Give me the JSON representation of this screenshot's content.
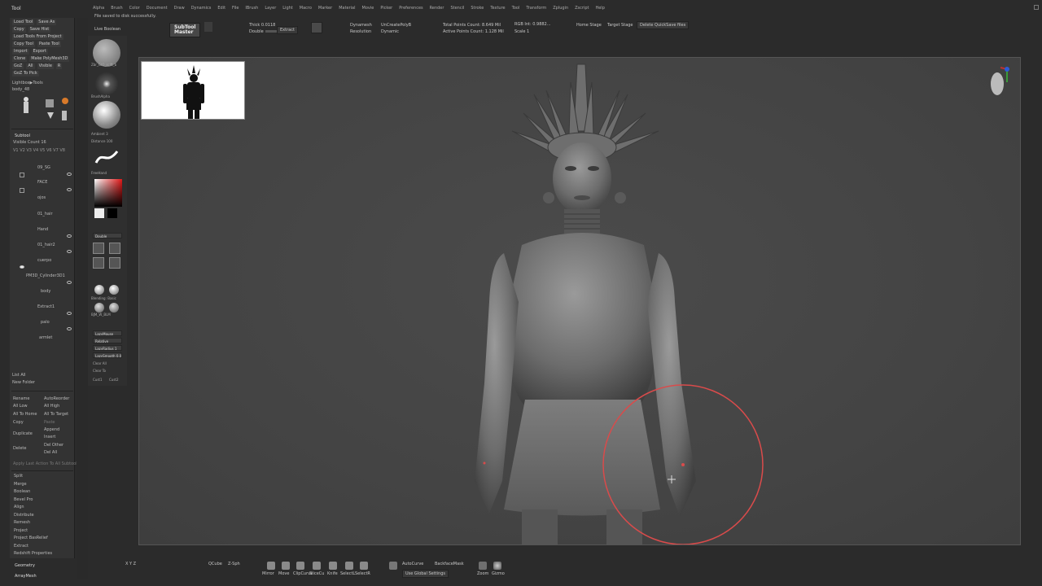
{
  "app": {
    "title": "Tool"
  },
  "menubar": {
    "items": [
      "Alpha",
      "Brush",
      "Color",
      "Document",
      "Draw",
      "Dynamics",
      "Edit",
      "File",
      "IBrush",
      "Layer",
      "Light",
      "Macro",
      "Marker",
      "Material",
      "Movie",
      "Picker",
      "Preferences",
      "Render",
      "Stencil",
      "Stroke",
      "Texture",
      "Tool",
      "Transform",
      "Zplugin",
      "Zscript",
      "Help"
    ]
  },
  "status": {
    "message": "File saved to disk successfully."
  },
  "top_shelf": {
    "live_boolean": "Live Boolean",
    "subtool_master_1": "SubTool",
    "subtool_master_2": "Master",
    "extract": "Extract",
    "thick": "Thick 0.0118",
    "double": "Double",
    "zremesher_1": "Dynamesh",
    "zremesher_2": "Resolution",
    "create_poly": "UnCreatePolyB",
    "dynamic": "Dynamic",
    "total_points": "Total Points Count: 8.649 Mil",
    "active_points": "Active Points Count: 1.128 Mil",
    "rgb": "RGB Int: 0.9882...",
    "scale": "Scale 1",
    "home_stage": "Home Stage",
    "target_stage": "Target Stage",
    "delete_quicksave": "Delete QuickSave files"
  },
  "left_panel": {
    "row1": [
      "Load Tool",
      "Save As"
    ],
    "row2": [
      "Copy",
      "Save Hist"
    ],
    "row3": [
      "Load Tools From Project"
    ],
    "row4": [
      "Copy Tool",
      "Paste Tool"
    ],
    "row5": [
      "Import",
      "Export"
    ],
    "row6": [
      "Clone",
      "Make PolyMesh3D"
    ],
    "row7": [
      "GoZ",
      "All",
      "Visible",
      "R"
    ],
    "row8": [
      "GoZ To Pick"
    ],
    "lightbox": "Lightbox▶Tools",
    "body_count": "body_48",
    "subtool_title": "Subtool",
    "visible_count": "Visible Count 16",
    "subtools": [
      "09_SG",
      "FACE",
      "ojos",
      "01_hair",
      "Hand",
      "01_hair2",
      "cuerpo",
      "PM3D_Cylinder3D1",
      "body",
      "Extract1",
      "palo",
      "armlet"
    ],
    "list_all": "List All",
    "new_folder": "New Folder",
    "ops": [
      [
        "Rename",
        "AutoReorder"
      ],
      [
        "All Low",
        "All High"
      ],
      [
        "All To Home",
        "All To Target"
      ],
      [
        "Copy",
        "Paste"
      ],
      [
        "Duplicate",
        "Append"
      ],
      [
        "",
        "Insert"
      ],
      [
        "Delete",
        "Del Other"
      ],
      [
        "",
        "Del All"
      ]
    ],
    "apply_text": "Apply Last Action To All Subtool",
    "menu": [
      "Split",
      "Merge",
      "Boolean",
      "Bevel Pro",
      "Align",
      "Distribute",
      "Remesh",
      "Project",
      "Project BasRelief",
      "Extract",
      "Redshift Properties"
    ],
    "bottom": [
      "Geometry",
      "ArrayMesh"
    ]
  },
  "palette2": {
    "items": [
      "Zbr_GIO_scift_b",
      "BrushAlpha",
      "Ambient 3",
      "Distance 100",
      "FreeHand",
      "Double",
      "Draw",
      "Scale",
      "Zgrid",
      "PolyF",
      "Fill",
      "LazyMouse",
      "Relative",
      "LazyRadius 1",
      "LazySmooth 0.08",
      "Clear All",
      "Clear To",
      "Cust1",
      "Cust2",
      "Blending: Basic",
      "BJM_W_BLM"
    ]
  },
  "bottom_shelf": {
    "items": [
      "QCube",
      "Z-Sph",
      "2",
      "Mirror",
      "Move",
      "ClipCurve",
      "SliceCu",
      "Knife",
      "SelectL",
      "SelectR",
      "Mask",
      "AutoCurve",
      "BackfaceMask",
      "Use Global Settings",
      "Zoom",
      "Gizmo"
    ]
  },
  "colors": {
    "accent": "#d23b3b",
    "panel": "#333333",
    "canvas": "#474747",
    "brush_circle": "#d94b4b"
  }
}
